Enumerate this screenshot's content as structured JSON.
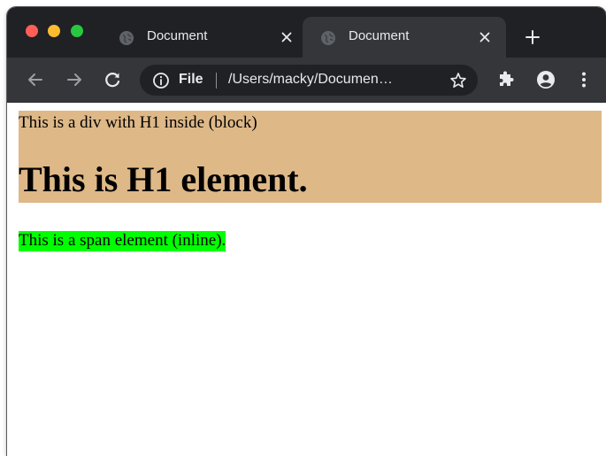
{
  "colors": {
    "tabstrip_bg": "#202124",
    "toolbar_bg": "#35363a",
    "close_red": "#ff5f57",
    "minimize_yellow": "#febc2e",
    "zoom_green": "#28c840",
    "div_bg": "#deb887",
    "span_bg": "#00ff00"
  },
  "tabs": [
    {
      "title": "Document",
      "active": false,
      "icon": "globe-icon"
    },
    {
      "title": "Document",
      "active": true,
      "icon": "globe-icon"
    }
  ],
  "toolbar": {
    "back_icon": "arrow-left-icon",
    "forward_icon": "arrow-right-icon",
    "reload_icon": "reload-icon",
    "extensions_icon": "puzzle-icon",
    "profile_icon": "account-icon",
    "menu_icon": "kebab-menu-icon"
  },
  "omnibox": {
    "scheme": "File",
    "url": "/Users/macky/Documen…"
  },
  "page": {
    "div_text": "This is a div with H1 inside (block)",
    "h1_text": "This is H1 element.",
    "span_text": "This is a span element (inline)."
  }
}
